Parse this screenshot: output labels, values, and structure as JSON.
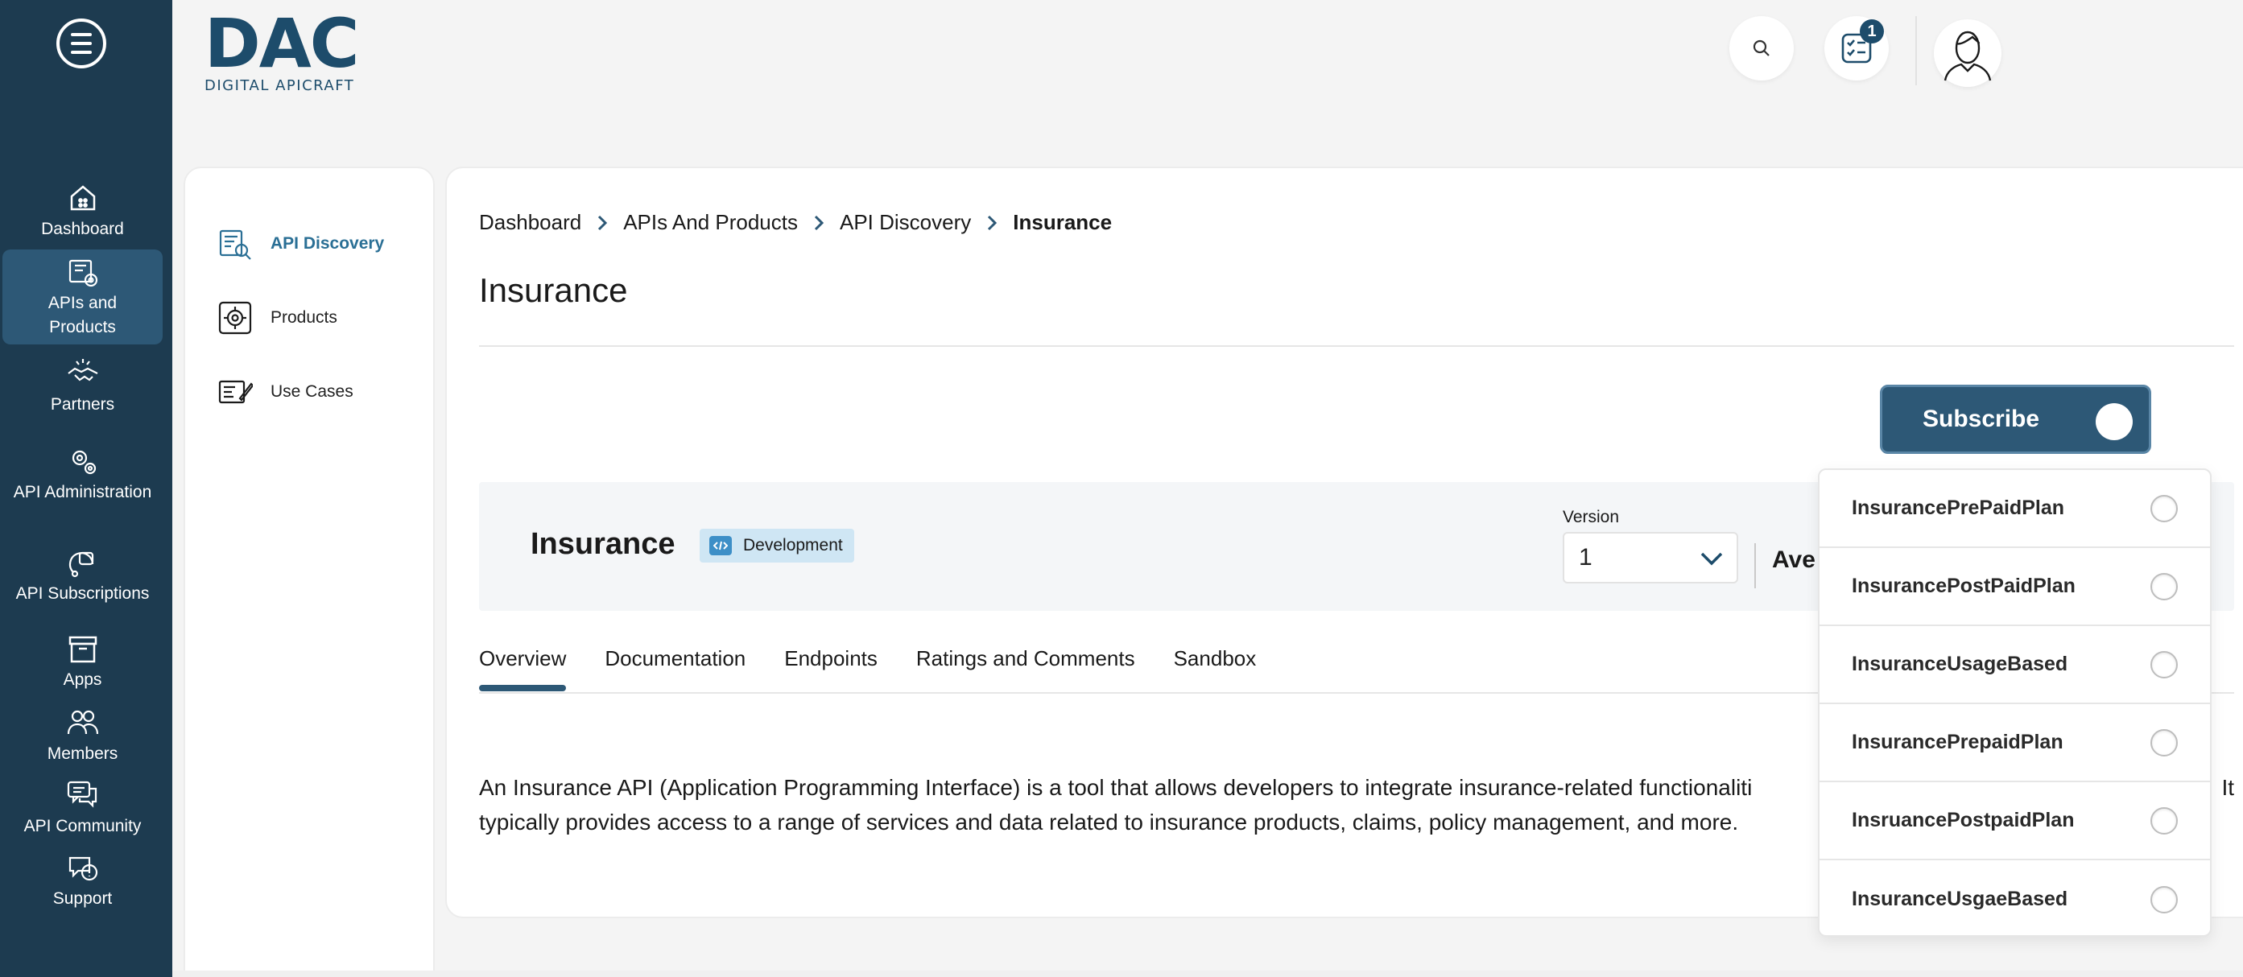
{
  "rail": {
    "items": [
      {
        "label": "Dashboard",
        "icon": "home-icon"
      },
      {
        "label": "APIs and Products",
        "icon": "api-products-icon"
      },
      {
        "label": "Partners",
        "icon": "handshake-icon"
      },
      {
        "label": "API Administration",
        "icon": "gears-icon"
      },
      {
        "label": "API Subscriptions",
        "icon": "subscriptions-icon"
      },
      {
        "label": "Apps",
        "icon": "box-icon"
      },
      {
        "label": "Members",
        "icon": "members-icon"
      },
      {
        "label": "API Community",
        "icon": "chat-icon"
      },
      {
        "label": "Support",
        "icon": "support-icon"
      }
    ],
    "active": "APIs and Products"
  },
  "header": {
    "logo_main": "DAC",
    "logo_sub": "DIGITAL APICRAFT",
    "tasks_badge": "1"
  },
  "subnav": {
    "items": [
      {
        "label": "API Discovery",
        "icon": "api-discovery-icon"
      },
      {
        "label": "Products",
        "icon": "products-gear-icon"
      },
      {
        "label": "Use Cases",
        "icon": "use-cases-icon"
      }
    ]
  },
  "breadcrumb": [
    "Dashboard",
    "APIs And Products",
    "API Discovery",
    "Insurance"
  ],
  "page_title": "Insurance",
  "subscribe_label": "Subscribe",
  "api": {
    "name": "Insurance",
    "environment": "Development",
    "version_label": "Version",
    "version_value": "1",
    "rating_text": "Ave"
  },
  "tabs": [
    "Overview",
    "Documentation",
    "Endpoints",
    "Ratings and Comments",
    "Sandbox"
  ],
  "active_tab": "Overview",
  "description": {
    "line1": "An Insurance API (Application Programming Interface) is a tool that allows developers to integrate insurance-related functionaliti",
    "line1_tail": "It",
    "line2": "typically provides access to a range of services and data related to insurance products, claims, policy management, and more."
  },
  "plans": [
    "InsurancePrePaidPlan",
    "InsurancePostPaidPlan",
    "InsuranceUsageBased",
    "InsurancePrepaidPlan",
    "InsruancePostpaidPlan",
    "InsuranceUsgaeBased"
  ],
  "colors": {
    "rail_bg": "#1d3b50",
    "rail_active": "#2d5876",
    "accent": "#2d5876",
    "link_active": "#2a6f95",
    "badge_env": "#cfe6f4"
  }
}
